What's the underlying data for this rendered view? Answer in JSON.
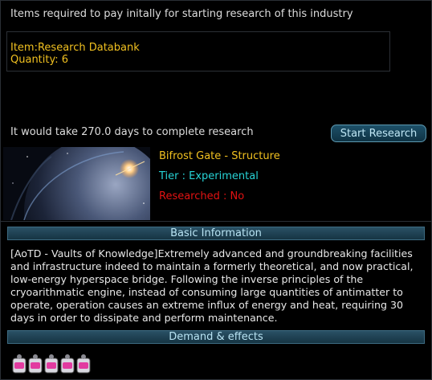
{
  "header": {
    "text": "Items required to pay initally for starting research of this industry"
  },
  "required_item": {
    "name": "Item:Research Databank",
    "quantity": "Quantity: 6"
  },
  "research": {
    "duration_text": "It would take 270.0 days to complete research",
    "start_label": "Start Research"
  },
  "industry": {
    "title": "Bifrost Gate - Structure",
    "tier": "Tier : Experimental",
    "researched": "Researched : No",
    "image_icon": "bifrost-gate-planet-image"
  },
  "basic_info": {
    "heading": "Basic Information",
    "lines": [
      "[AoTD - Vaults of Knowledge]Extremely advanced and groundbreaking facilities",
      "and infrastructure indeed to maintain a formerly theoretical, and now practical,",
      "low-energy hyperspace bridge. Following the inverse principles of the",
      "cryoarithmatic engine, instead of consuming large quantities of antimatter to",
      "operate, operation causes an extreme influx of energy and heat, requiring 30",
      "days in order to dissipate and perform maintenance."
    ]
  },
  "demand": {
    "heading": "Demand & effects",
    "icon": "commodity-stack-icon",
    "icon_count": 5
  },
  "colors": {
    "gold": "#f0c020",
    "cyan": "#27d3d6",
    "red": "#e21212",
    "bar": "#2a5165"
  }
}
